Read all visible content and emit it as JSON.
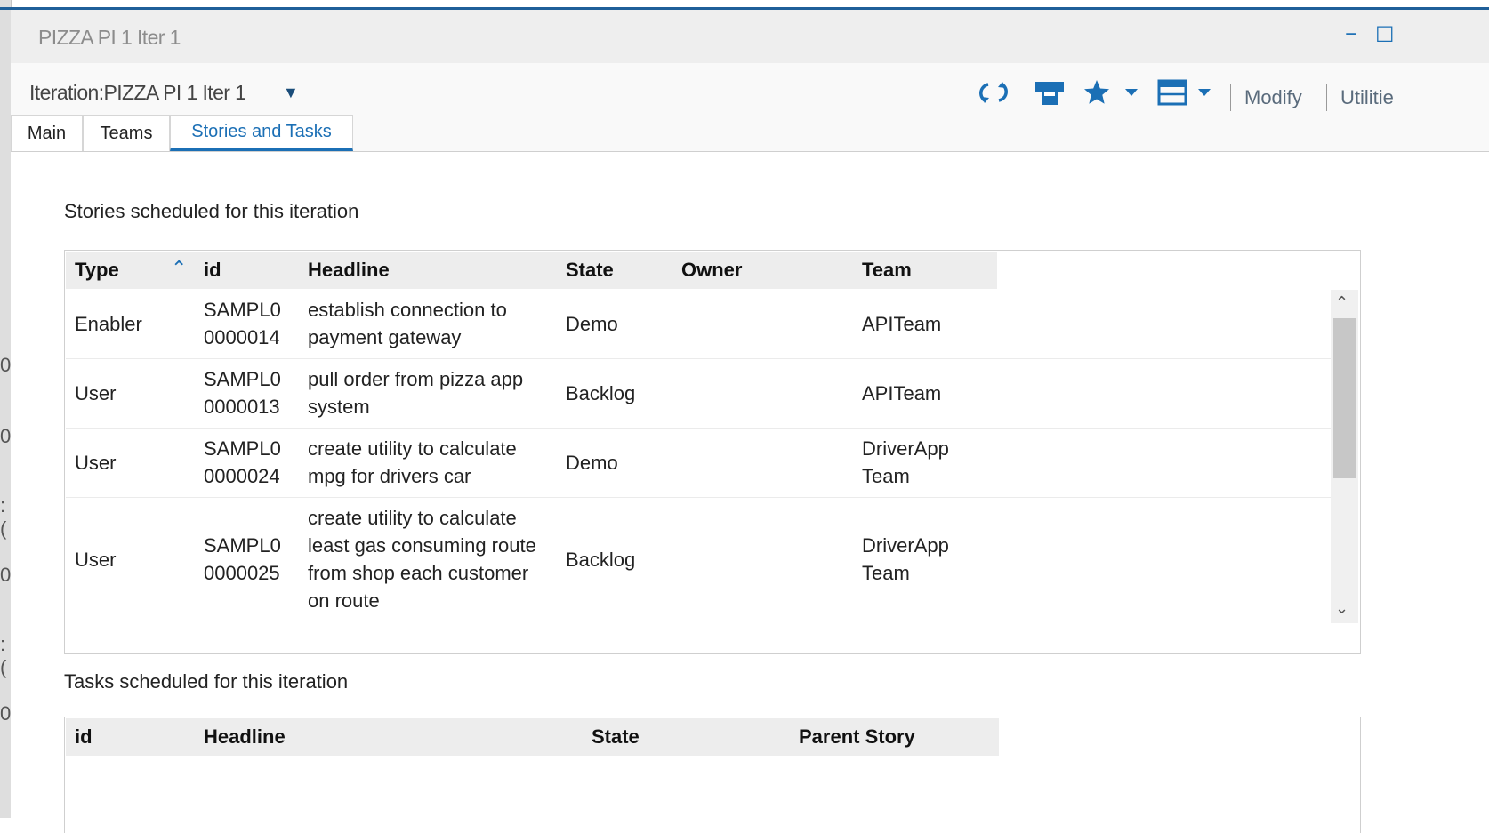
{
  "window": {
    "title": "PIZZA PI 1 Iter 1",
    "controls": {
      "minimize": "−",
      "maximize": "☐"
    },
    "accent_color": "#1b6fb5"
  },
  "header": {
    "title": "Iteration:PIZZA PI 1 Iter 1",
    "toolbar": {
      "refresh_icon": "refresh-icon",
      "print_icon": "print-icon",
      "favorite_icon": "star-icon",
      "layout_icon": "calendar-layout-icon",
      "modify_label": "Modify",
      "utilities_label": "Utilitie"
    }
  },
  "tabs": [
    {
      "label": "Main",
      "active": false
    },
    {
      "label": "Teams",
      "active": false
    },
    {
      "label": "Stories and Tasks",
      "active": true
    }
  ],
  "stories": {
    "label": "Stories scheduled for this iteration",
    "columns": [
      "Type",
      "id",
      "Headline",
      "State",
      "Owner",
      "Team"
    ],
    "sort": {
      "column": "Type",
      "direction": "ascending"
    },
    "rows": [
      {
        "type": "Enabler",
        "id_l1": "SAMPL0",
        "id_l2": "0000014",
        "headline": [
          "establish connection to",
          "payment gateway"
        ],
        "state": "Demo",
        "owner": "",
        "team": [
          "APITeam"
        ]
      },
      {
        "type": "User",
        "id_l1": "SAMPL0",
        "id_l2": "0000013",
        "headline": [
          "pull order from pizza app",
          "system"
        ],
        "state": "Backlog",
        "owner": "",
        "team": [
          "APITeam"
        ]
      },
      {
        "type": "User",
        "id_l1": "SAMPL0",
        "id_l2": "0000024",
        "headline": [
          "create utility to calculate",
          "mpg for drivers car"
        ],
        "state": "Demo",
        "owner": "",
        "team": [
          "DriverApp",
          "Team"
        ]
      },
      {
        "type": "User",
        "id_l1": "SAMPL0",
        "id_l2": "0000025",
        "headline": [
          "create utility to calculate",
          "least gas consuming route",
          "from shop each customer",
          "on route"
        ],
        "state": "Backlog",
        "owner": "",
        "team": [
          "DriverApp",
          "Team"
        ]
      }
    ]
  },
  "tasks": {
    "label": "Tasks scheduled for this iteration",
    "columns": [
      "id",
      "Headline",
      "State",
      "Parent Story"
    ]
  }
}
